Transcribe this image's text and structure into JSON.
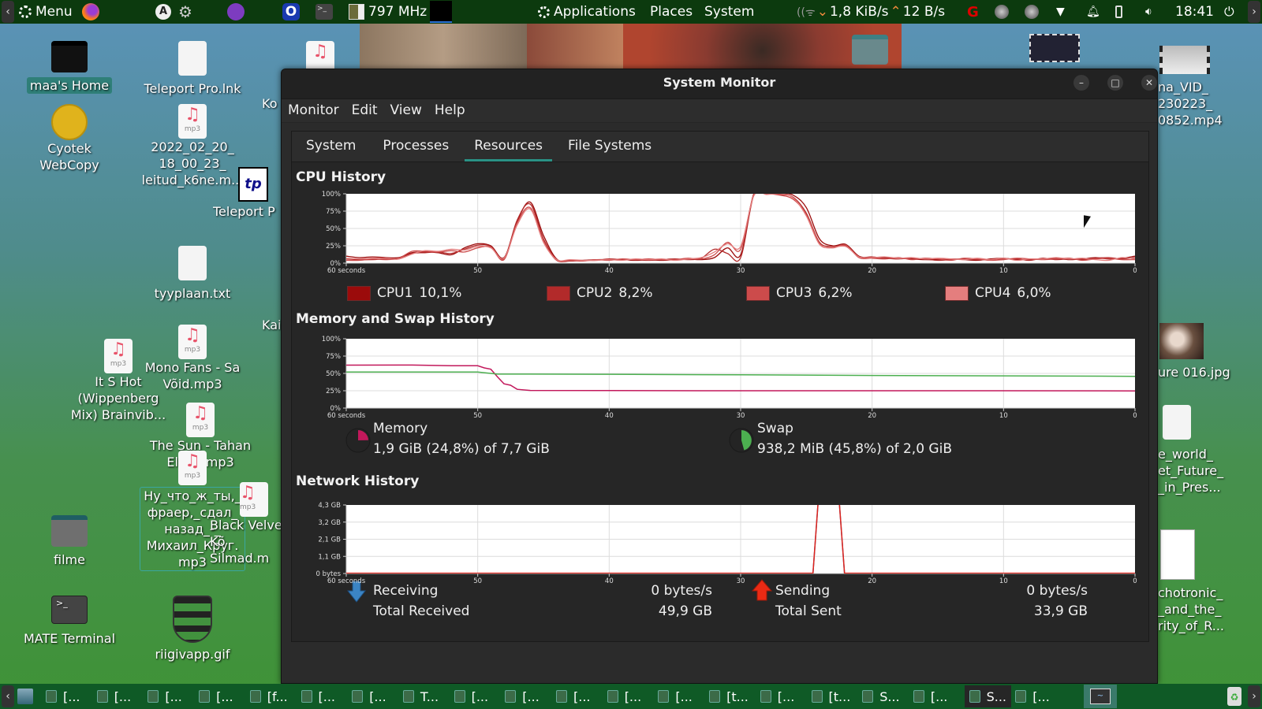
{
  "top_panel": {
    "menu_label": "Menu",
    "cpu_freq": "797 MHz",
    "applications": "Applications",
    "places": "Places",
    "system": "System",
    "net_down": "1,8 KiB/s",
    "net_up": "12 B/s",
    "clock": "18:41"
  },
  "desktop": {
    "icons": [
      {
        "label": "maa's Home",
        "type": "home-folder"
      },
      {
        "label": "Teleport Pro.lnk",
        "type": "file"
      },
      {
        "label": "Cyotek\nWebCopy",
        "type": "app"
      },
      {
        "label": "2022_02_20_\n18_00_23_\nleitud_k6ne.m...",
        "type": "mp3"
      },
      {
        "label": "Teleport P",
        "type": "teleport"
      },
      {
        "label": "tyyplaan.txt",
        "type": "file"
      },
      {
        "label": "Mono Fans - Sa\nVõid.mp3",
        "type": "mp3"
      },
      {
        "label": "It S Hot\n(Wippenberg\nMix)  Brainvib...",
        "type": "mp3"
      },
      {
        "label": "The Sun - Tahan\nElada.mp3",
        "type": "mp3"
      },
      {
        "label": "Ну_что_ж_ты,_\nфраер,_сдал_\nназад_-_\nМихаил_Круг.\nmp3",
        "type": "mp3"
      },
      {
        "label": "Black Velve\nKõ Silmad.m",
        "type": "mp3"
      },
      {
        "label": "filme",
        "type": "folder"
      },
      {
        "label": "MATE Terminal",
        "type": "terminal"
      },
      {
        "label": "riigivapp.gif",
        "type": "image"
      },
      {
        "label": "Ko",
        "type": "partial"
      },
      {
        "label": "Kai",
        "type": "partial"
      },
      {
        "label": "na_VID_\n230223_\n0852.mp4",
        "type": "video"
      },
      {
        "label": "ure 016.jpg",
        "type": "image"
      },
      {
        "label": "e_world_\net_Future_\n_in_Pres...",
        "type": "file"
      },
      {
        "label": "chotronic_\n_and_the_\nrity_of_R...",
        "type": "pdf"
      }
    ],
    "mp3_badge": "mp3"
  },
  "window": {
    "title": "System Monitor",
    "menu": [
      "Monitor",
      "Edit",
      "View",
      "Help"
    ],
    "tabs": [
      "System",
      "Processes",
      "Resources",
      "File Systems"
    ],
    "active_tab": "Resources",
    "cpu": {
      "title": "CPU History",
      "legend": [
        {
          "name": "CPU1",
          "value": "10,1%",
          "color": "#9b0b0b"
        },
        {
          "name": "CPU2",
          "value": "8,2%",
          "color": "#b22a2a"
        },
        {
          "name": "CPU3",
          "value": "6,2%",
          "color": "#cc4b4b"
        },
        {
          "name": "CPU4",
          "value": "6,0%",
          "color": "#e47e7e"
        }
      ]
    },
    "memory": {
      "title": "Memory and Swap History",
      "mem_label": "Memory",
      "mem_value": "1,9 GiB (24,8%) of 7,7 GiB",
      "mem_fraction": 0.248,
      "mem_color": "#c2185b",
      "swap_label": "Swap",
      "swap_value": "938,2 MiB (45,8%) of 2,0 GiB",
      "swap_fraction": 0.458,
      "swap_color": "#4caf50"
    },
    "network": {
      "title": "Network History",
      "receiving_label": "Receiving",
      "receiving_value": "0 bytes/s",
      "total_received_label": "Total Received",
      "total_received_value": "49,9 GB",
      "sending_label": "Sending",
      "sending_value": "0 bytes/s",
      "total_sent_label": "Total Sent",
      "total_sent_value": "33,9 GB"
    }
  },
  "taskbar": {
    "items": [
      "[...",
      "[...",
      "[...",
      "[...",
      "[f...",
      "[...",
      "[...",
      "T...",
      "[...",
      "[...",
      "[...",
      "[...",
      "[...",
      "[t...",
      "[...",
      "[t...",
      "S...",
      "[...",
      "S...",
      "[..."
    ],
    "active_index": 18
  },
  "chart_data": [
    {
      "type": "line",
      "title": "CPU History",
      "xlabel": "seconds",
      "x_ticks": [
        "60 seconds",
        "50",
        "40",
        "30",
        "20",
        "10",
        "0"
      ],
      "y_ticks": [
        "0%",
        "25%",
        "50%",
        "75%",
        "100%"
      ],
      "ylim": [
        0,
        100
      ],
      "xlim": [
        60,
        0
      ],
      "grid": true,
      "x": [
        60,
        59,
        58,
        57,
        56,
        55,
        54,
        53,
        52,
        51,
        50,
        49,
        48,
        47,
        46,
        45,
        44,
        43,
        42,
        41,
        40,
        39,
        38,
        37,
        36,
        35,
        34,
        33,
        32,
        31,
        30,
        29,
        28,
        27,
        26,
        25,
        24,
        23,
        22,
        21,
        20,
        19,
        18,
        17,
        16,
        15,
        14,
        13,
        12,
        11,
        10,
        9,
        8,
        7,
        6,
        5,
        4,
        3,
        2,
        1,
        0
      ],
      "series": [
        {
          "name": "CPU1",
          "color": "#9b0b0b",
          "values": [
            10,
            8,
            9,
            8,
            8,
            15,
            16,
            15,
            12,
            22,
            28,
            25,
            8,
            60,
            88,
            40,
            6,
            4,
            4,
            5,
            5,
            5,
            4,
            5,
            4,
            5,
            6,
            5,
            8,
            22,
            12,
            100,
            100,
            100,
            98,
            80,
            35,
            25,
            27,
            10,
            8,
            8,
            7,
            6,
            5,
            5,
            6,
            5,
            4,
            6,
            7,
            5,
            5,
            6,
            7,
            5,
            6,
            8,
            6,
            7,
            10
          ]
        },
        {
          "name": "CPU2",
          "color": "#b22a2a",
          "values": [
            6,
            5,
            5,
            6,
            6,
            14,
            15,
            16,
            14,
            20,
            26,
            24,
            6,
            62,
            85,
            35,
            5,
            3,
            4,
            4,
            6,
            5,
            5,
            4,
            5,
            6,
            5,
            7,
            20,
            14,
            8,
            98,
            100,
            99,
            95,
            72,
            30,
            24,
            25,
            9,
            9,
            7,
            6,
            7,
            6,
            4,
            5,
            6,
            5,
            5,
            6,
            6,
            4,
            7,
            5,
            6,
            5,
            7,
            8,
            6,
            8
          ]
        },
        {
          "name": "CPU3",
          "color": "#cc4b4b",
          "values": [
            4,
            4,
            6,
            5,
            7,
            17,
            17,
            16,
            18,
            16,
            22,
            23,
            5,
            58,
            80,
            32,
            4,
            4,
            3,
            5,
            4,
            6,
            5,
            6,
            5,
            5,
            7,
            6,
            12,
            30,
            20,
            99,
            100,
            98,
            92,
            70,
            28,
            22,
            26,
            8,
            7,
            6,
            8,
            5,
            7,
            6,
            4,
            7,
            6,
            4,
            5,
            7,
            6,
            5,
            6,
            7,
            4,
            6,
            7,
            5,
            5
          ]
        },
        {
          "name": "CPU4",
          "color": "#e47e7e",
          "values": [
            7,
            6,
            7,
            7,
            6,
            13,
            18,
            17,
            20,
            19,
            24,
            22,
            7,
            55,
            78,
            30,
            5,
            5,
            4,
            4,
            5,
            4,
            6,
            5,
            6,
            4,
            6,
            8,
            16,
            28,
            24,
            97,
            99,
            100,
            94,
            68,
            27,
            23,
            24,
            9,
            8,
            9,
            7,
            8,
            6,
            7,
            6,
            5,
            7,
            5,
            7,
            4,
            6,
            6,
            8,
            6,
            7,
            5,
            4,
            8,
            6
          ]
        }
      ]
    },
    {
      "type": "line",
      "title": "Memory and Swap History",
      "x_ticks": [
        "60 seconds",
        "50",
        "40",
        "30",
        "20",
        "10",
        "0"
      ],
      "y_ticks": [
        "0%",
        "25%",
        "50%",
        "75%",
        "100%"
      ],
      "ylim": [
        0,
        100
      ],
      "xlim": [
        60,
        0
      ],
      "grid": true,
      "x": [
        60,
        55,
        52,
        50,
        49.5,
        49,
        48.5,
        48,
        47.5,
        47,
        46,
        40,
        30,
        20,
        10,
        0
      ],
      "series": [
        {
          "name": "Memory",
          "color": "#c2185b",
          "values": [
            62,
            62,
            61,
            61,
            58,
            56,
            45,
            35,
            33,
            27,
            25.5,
            25.2,
            25,
            25,
            25,
            24.8
          ]
        },
        {
          "name": "Swap",
          "color": "#4caf50",
          "values": [
            52,
            52,
            52,
            52,
            51,
            50,
            49,
            49,
            49,
            49,
            49,
            48.8,
            48,
            47,
            46.5,
            45.8
          ]
        }
      ]
    },
    {
      "type": "line",
      "title": "Network History",
      "x_ticks": [
        "60 seconds",
        "50",
        "40",
        "30",
        "20",
        "10",
        "0"
      ],
      "y_ticks": [
        "0 bytes",
        "1,1 GB",
        "2,1 GB",
        "3,2 GB",
        "4,3 GB"
      ],
      "ylim": [
        0,
        4.3
      ],
      "xlim": [
        60,
        0
      ],
      "grid": true,
      "x": [
        60,
        24.5,
        24.1,
        22.5,
        22.1,
        0
      ],
      "series": [
        {
          "name": "Receiving",
          "color": "#2f6fb3",
          "values": [
            0,
            0,
            5,
            5,
            0,
            0
          ]
        },
        {
          "name": "Sending",
          "color": "#e0231b",
          "values": [
            0.02,
            0.02,
            5,
            5,
            0.02,
            0.02
          ]
        }
      ]
    }
  ]
}
